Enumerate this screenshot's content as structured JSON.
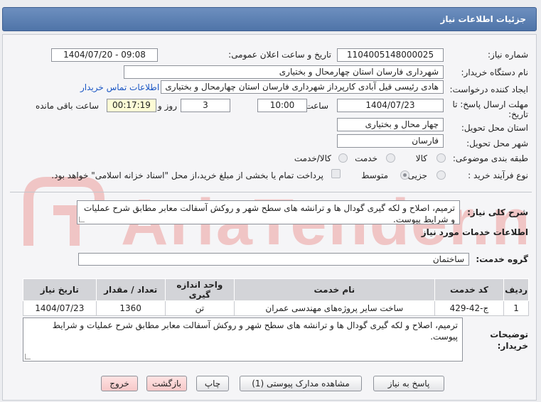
{
  "header": {
    "title": "جزئیات اطلاعات نیاز"
  },
  "form": {
    "need_number_label": "شماره نیاز:",
    "need_number": "1104005148000025",
    "announce_label": "تاریخ و ساعت اعلان عمومی:",
    "announce_value": "1404/07/20 - 09:08",
    "buyer_org_label": "نام دستگاه خریدار:",
    "buyer_org": "شهرداری فارسان استان چهارمحال و بختیاری",
    "creator_label": "ایجاد کننده درخواست:",
    "creator": "هادی رئیسی قیل آبادی کارپرداز شهرداری فارسان استان چهارمحال و بختیاری",
    "contact_link": "اطلاعات تماس خریدار",
    "deadline_label_1": "مهلت ارسال پاسخ: تا",
    "deadline_label_2": "تاریخ:",
    "deadline_date": "1404/07/23",
    "time_label": "ساعت",
    "deadline_time": "10:00",
    "days_value": "3",
    "days_label": "روز و",
    "remaining_time": "00:17:19",
    "remaining_label": "ساعت باقی مانده",
    "province_label": "استان محل تحویل:",
    "province": "چهار محال و بختیاری",
    "city_label": "شهر محل تحویل:",
    "city": "فارسان",
    "category_label": "طبقه بندی موضوعی:",
    "category_options": [
      "کالا",
      "خدمت",
      "کالا/خدمت"
    ],
    "process_label": "نوع فرآیند خرید :",
    "process_options": [
      "جزیی",
      "متوسط"
    ],
    "payment_note": "پرداخت تمام یا بخشی از مبلغ خرید،از محل \"اسناد خزانه اسلامی\" خواهد بود."
  },
  "description": {
    "label": "شرح کلی نیاز:",
    "text": "ترمیم، اصلاح و لکه گیری گودال ها و ترانشه های سطح شهر و روکش آسفالت معابر مطابق شرح عملیات و شرایط پیوست."
  },
  "services": {
    "section_title": "اطلاعات خدمات مورد نیاز",
    "group_label": "گروه خدمت:",
    "group_value": "ساختمان",
    "columns": [
      "ردیف",
      "کد خدمت",
      "نام خدمت",
      "واحد اندازه گیری",
      "تعداد / مقدار",
      "تاریخ نیاز"
    ],
    "rows": [
      {
        "index": "1",
        "code": "ج-42-429",
        "name": "ساخت سایر پروژه‌های مهندسی عمران",
        "unit": "تن",
        "qty": "1360",
        "date": "1404/07/23"
      }
    ]
  },
  "buyer_notes": {
    "label_1": "توضیحات",
    "label_2": "خریدار:",
    "text": "ترمیم، اصلاح و لکه گیری گودال ها و ترانشه های سطح شهر و روکش آسفالت معابر مطابق شرح عملیات و شرایط پیوست."
  },
  "buttons": {
    "reply": "پاسخ به نیاز",
    "attachments": "مشاهده مدارک پیوستی (1)",
    "print": "چاپ",
    "back": "بازگشت",
    "exit": "خروج"
  },
  "watermark": {
    "text": "AriaTender.net"
  },
  "colors": {
    "header": "#5b7db0",
    "link": "#1a56c4",
    "watermark": "#f0c5c5"
  }
}
